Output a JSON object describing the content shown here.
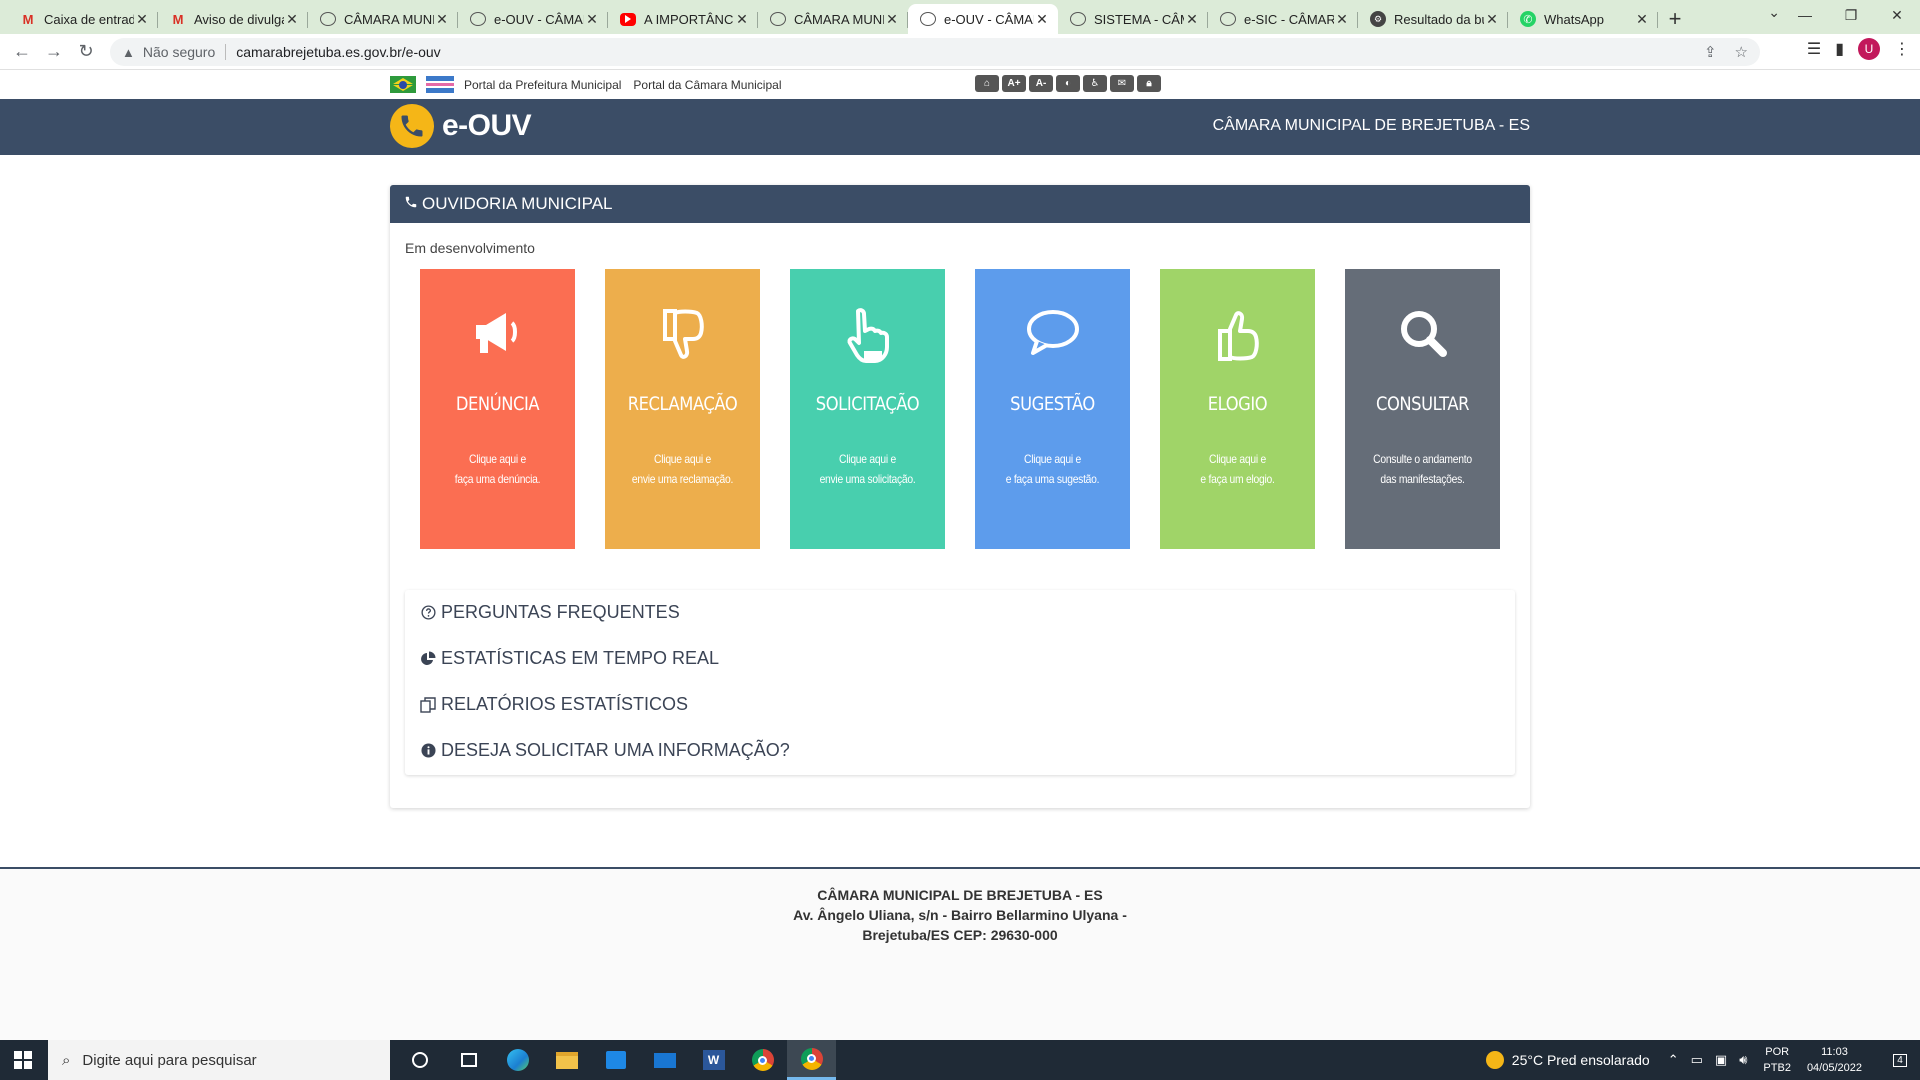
{
  "browser": {
    "tabs": [
      {
        "title": "Caixa de entrada",
        "icon": "gmail-icon",
        "active": false
      },
      {
        "title": "Aviso de divulgação",
        "icon": "gmail-icon",
        "active": false
      },
      {
        "title": "CÂMARA MUNICIPAL",
        "icon": "globe-icon",
        "active": false
      },
      {
        "title": "e-OUV - CÂMARA",
        "icon": "globe-icon",
        "active": false
      },
      {
        "title": "A IMPORTÂNCIA",
        "icon": "youtube-icon",
        "active": false
      },
      {
        "title": "CÂMARA MUNICIPAL",
        "icon": "globe-icon",
        "active": false
      },
      {
        "title": "e-OUV - CÂMARA",
        "icon": "globe-icon",
        "active": true
      },
      {
        "title": "SISTEMA - CÂMARA",
        "icon": "globe-icon",
        "active": false
      },
      {
        "title": "e-SIC - CÂMARA",
        "icon": "globe-icon",
        "active": false
      },
      {
        "title": "Resultado da busca",
        "icon": "result-icon",
        "active": false
      },
      {
        "title": "WhatsApp",
        "icon": "whatsapp-icon",
        "active": false
      }
    ],
    "security_label": "Não seguro",
    "url": "camarabrejetuba.es.gov.br/e-ouv",
    "avatar_letter": "U"
  },
  "topbar": {
    "link_prefeitura": "Portal da Prefeitura Municipal",
    "link_camara": "Portal da Câmara Municipal"
  },
  "header": {
    "logo_text": "e-OUV",
    "title": "CÂMARA MUNICIPAL DE BREJETUBA - ES"
  },
  "panel": {
    "title": "OUVIDORIA MUNICIPAL",
    "status": "Em desenvolvimento"
  },
  "cards": [
    {
      "title": "DENÚNCIA",
      "line1": "Clique aqui e",
      "line2": "faça uma denúncia.",
      "color": "#fb6e52",
      "icon": "megaphone-icon"
    },
    {
      "title": "RECLAMAÇÃO",
      "line1": "Clique aqui e",
      "line2": "envie uma reclamação.",
      "color": "#edae4c",
      "icon": "thumbs-down-icon"
    },
    {
      "title": "SOLICITAÇÃO",
      "line1": "Clique aqui e",
      "line2": "envie uma solicitação.",
      "color": "#48cfae",
      "icon": "pointing-hand-icon"
    },
    {
      "title": "SUGESTÃO",
      "line1": "Clique aqui e",
      "line2": "e faça uma sugestão.",
      "color": "#5d9cec",
      "icon": "speech-bubble-icon"
    },
    {
      "title": "ELOGIO",
      "line1": "Clique aqui e",
      "line2": "e faça um elogio.",
      "color": "#a0d468",
      "icon": "thumbs-up-icon"
    },
    {
      "title": "CONSULTAR",
      "line1": "Consulte o andamento",
      "line2": "das manifestações.",
      "color": "#656d78",
      "icon": "search-icon"
    }
  ],
  "links": [
    {
      "label": "PERGUNTAS FREQUENTES",
      "icon": "question-circle-icon"
    },
    {
      "label": "ESTATÍSTICAS EM TEMPO REAL",
      "icon": "pie-chart-icon"
    },
    {
      "label": "RELATÓRIOS ESTATÍSTICOS",
      "icon": "copy-documents-icon"
    },
    {
      "label": "DESEJA SOLICITAR UMA INFORMAÇÃO?",
      "icon": "info-circle-icon"
    }
  ],
  "footer": {
    "line1": "CÂMARA MUNICIPAL DE BREJETUBA - ES",
    "line2": "Av. Ângelo Uliana, s/n - Bairro Bellarmino Ulyana -",
    "line3": "Brejetuba/ES CEP: 29630-000"
  },
  "taskbar": {
    "search_placeholder": "Digite aqui para pesquisar",
    "weather": "25°C  Pred ensolarado",
    "lang1": "POR",
    "lang2": "PTB2",
    "time": "11:03",
    "date": "04/05/2022",
    "notification_count": "4"
  }
}
